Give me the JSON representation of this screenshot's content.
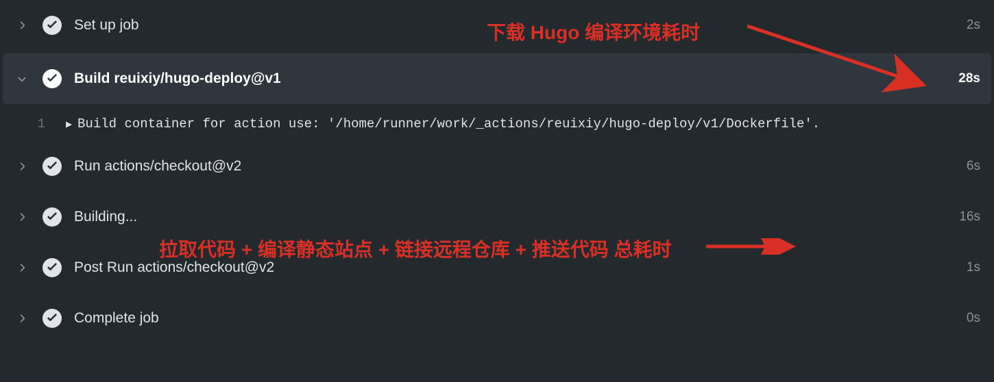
{
  "steps": [
    {
      "label": "Set up job",
      "duration": "2s",
      "expanded": false
    },
    {
      "label": "Build reuixiy/hugo-deploy@v1",
      "duration": "28s",
      "expanded": true
    },
    {
      "label": "Run actions/checkout@v2",
      "duration": "6s",
      "expanded": false
    },
    {
      "label": "Building...",
      "duration": "16s",
      "expanded": false
    },
    {
      "label": "Post Run actions/checkout@v2",
      "duration": "1s",
      "expanded": false
    },
    {
      "label": "Complete job",
      "duration": "0s",
      "expanded": false
    }
  ],
  "log": {
    "lineno": "1",
    "text": "Build container for action use: '/home/runner/work/_actions/reuixiy/hugo-deploy/v1/Dockerfile'."
  },
  "annotations": {
    "top": "下载 Hugo 编译环境耗时",
    "mid": "拉取代码 + 编译静态站点 + 链接远程仓库 + 推送代码 总耗时"
  }
}
